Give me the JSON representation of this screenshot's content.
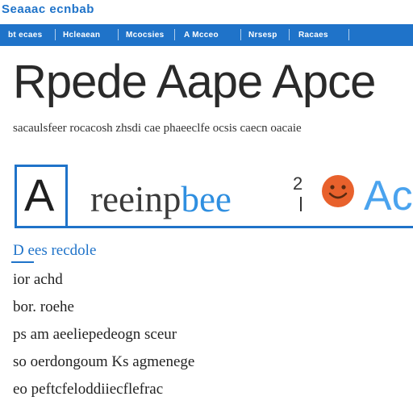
{
  "header": {
    "logo_text": "Seaaac ecnbab"
  },
  "nav": {
    "items": [
      "bt ecaes",
      "Hcleaean",
      "Mcocsies",
      "A Mcceo",
      "Nrsesp",
      "Racaes"
    ]
  },
  "page": {
    "headline": "Rpede Aape Apce",
    "subline": "sacaulsfeer rocacosh zhsdi cae phaeeclfe ocsis caecn oacaie"
  },
  "banner": {
    "letter": "A",
    "word_dark": "reeinp",
    "word_accent": "bee",
    "mark": "2",
    "tail": "Ac",
    "smile_color": "#e8612c"
  },
  "menu": {
    "items": [
      {
        "label": "D  ees recdole"
      },
      {
        "label": "ior achd"
      },
      {
        "label": "bor. roehe"
      },
      {
        "label": "ps  am aeeliepedeogn sceur"
      },
      {
        "label": "so  oerdongoum Ks  agmenege"
      },
      {
        "label": "eo  peftcfeloddiiecflefrac"
      }
    ]
  },
  "colors": {
    "accent": "#1f73c9",
    "accent_light": "#4aa3ee",
    "text": "#222222"
  }
}
